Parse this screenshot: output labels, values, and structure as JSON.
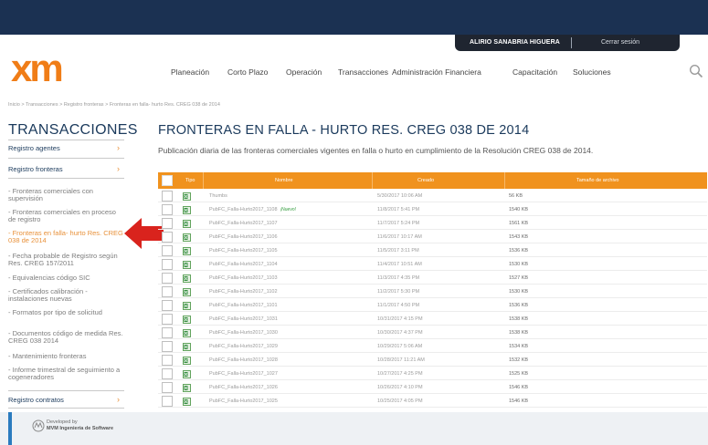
{
  "user": {
    "name": "ALIRIO SANABRIA HIGUERA",
    "logout_label": "Cerrar sesión"
  },
  "logo_text": "xm",
  "nav": [
    "Planeación",
    "Corto Plazo",
    "Operación",
    "Transacciones",
    "Administración Financiera",
    "Capacitación",
    "Soluciones"
  ],
  "breadcrumb": "Inicio > Transacciones > Registro fronteras > Fronteras en falla- hurto Res. CREG 038 de 2014",
  "sidebar": {
    "title": "TRANSACCIONES",
    "link1": "Registro agentes",
    "link2": "Registro fronteras",
    "link3": "Registro contratos",
    "sub": [
      "- Fronteras comerciales con supervisión",
      "- Fronteras comerciales en proceso de registro",
      "- Fronteras en falla- hurto Res. CREG 038 de 2014",
      "- Fecha probable de Registro según Res. CREG 157/2011",
      "- Equivalencias código SIC",
      "- Certificados calibración - instalaciones nuevas",
      "- Formatos por tipo de solicitud",
      "- Documentos código de medida Res. CREG 038 2014",
      "- Mantenimiento fronteras",
      "- Informe trimestral de seguimiento a cogeneradores"
    ]
  },
  "main": {
    "title": "FRONTERAS EN FALLA - HURTO RES. CREG 038 DE 2014",
    "subtitle": "Publicación diaria de las fronteras comerciales vigentes en falla o hurto en cumplimiento de la Resolución CREG 038 de 2014."
  },
  "table": {
    "headers": {
      "tipo": "Tipo",
      "nombre": "Nombre",
      "creado": "Creado",
      "tamano": "Tamaño de archivo"
    },
    "new_badge": "¡Nuevo!",
    "rows": [
      {
        "nombre": "Thumbs",
        "creado": "5/30/2017 10:06 AM",
        "tamano": "56 KB",
        "nuevo": false
      },
      {
        "nombre": "PubFC_Falla-Hurto2017_1108",
        "creado": "11/8/2017 5:41 PM",
        "tamano": "1540 KB",
        "nuevo": true
      },
      {
        "nombre": "PubFC_Falla-Hurto2017_1107",
        "creado": "11/7/2017 5:24 PM",
        "tamano": "1561 KB",
        "nuevo": false
      },
      {
        "nombre": "PubFC_Falla-Hurto2017_1106",
        "creado": "11/6/2017 10:17 AM",
        "tamano": "1543 KB",
        "nuevo": false
      },
      {
        "nombre": "PubFC_Falla-Hurto2017_1105",
        "creado": "11/5/2017 3:11 PM",
        "tamano": "1536 KB",
        "nuevo": false
      },
      {
        "nombre": "PubFC_Falla-Hurto2017_1104",
        "creado": "11/4/2017 10:51 AM",
        "tamano": "1530 KB",
        "nuevo": false
      },
      {
        "nombre": "PubFC_Falla-Hurto2017_1103",
        "creado": "11/3/2017 4:35 PM",
        "tamano": "1527 KB",
        "nuevo": false
      },
      {
        "nombre": "PubFC_Falla-Hurto2017_1102",
        "creado": "11/2/2017 5:30 PM",
        "tamano": "1530 KB",
        "nuevo": false
      },
      {
        "nombre": "PubFC_Falla-Hurto2017_1101",
        "creado": "11/1/2017 4:50 PM",
        "tamano": "1536 KB",
        "nuevo": false
      },
      {
        "nombre": "PubFC_Falla-Hurto2017_1031",
        "creado": "10/31/2017 4:15 PM",
        "tamano": "1538 KB",
        "nuevo": false
      },
      {
        "nombre": "PubFC_Falla-Hurto2017_1030",
        "creado": "10/30/2017 4:37 PM",
        "tamano": "1538 KB",
        "nuevo": false
      },
      {
        "nombre": "PubFC_Falla-Hurto2017_1029",
        "creado": "10/29/2017 5:06 AM",
        "tamano": "1534 KB",
        "nuevo": false
      },
      {
        "nombre": "PubFC_Falla-Hurto2017_1028",
        "creado": "10/28/2017 11:21 AM",
        "tamano": "1532 KB",
        "nuevo": false
      },
      {
        "nombre": "PubFC_Falla-Hurto2017_1027",
        "creado": "10/27/2017 4:25 PM",
        "tamano": "1525 KB",
        "nuevo": false
      },
      {
        "nombre": "PubFC_Falla-Hurto2017_1026",
        "creado": "10/26/2017 4:10 PM",
        "tamano": "1546 KB",
        "nuevo": false
      },
      {
        "nombre": "PubFC_Falla-Hurto2017_1025",
        "creado": "10/25/2017 4:05 PM",
        "tamano": "1546 KB",
        "nuevo": false
      }
    ]
  },
  "footer": {
    "line1": "Developed by",
    "line2": "MVM Ingeniería de Software"
  },
  "icons": {
    "search": "search-icon",
    "file": "excel-file-icon",
    "arrow": "red-arrow-icon",
    "chevron": "chevron-right-icon"
  },
  "colors": {
    "accent": "#f0921e",
    "navy": "#1b3152",
    "title": "#1b3a5c",
    "arrow": "#d9231d"
  }
}
